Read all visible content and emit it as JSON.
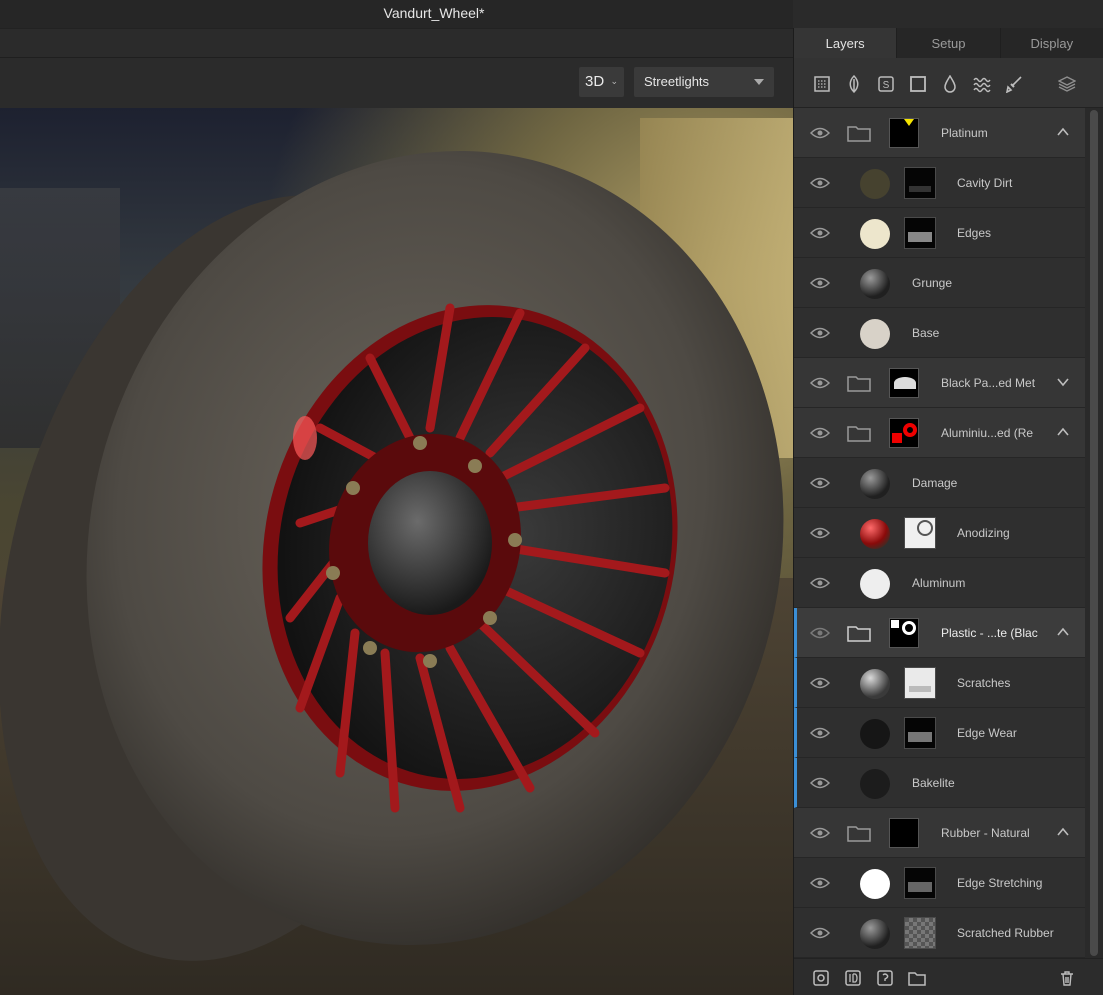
{
  "window": {
    "title": "Vandurt_Wheel*"
  },
  "viewport_toolbar": {
    "view_mode": "3D",
    "environment": "Streetlights"
  },
  "panel": {
    "tabs": [
      {
        "label": "Layers",
        "active": true
      },
      {
        "label": "Setup",
        "active": false
      },
      {
        "label": "Display",
        "active": false
      }
    ],
    "toolbar_icons": [
      "grid-icon",
      "leaf-icon",
      "smart-material-icon",
      "square-icon",
      "drop-icon",
      "waves-icon",
      "brush-icon",
      "layers-stack-icon"
    ],
    "layers": [
      {
        "type": "group",
        "label": "Platinum",
        "expanded": true
      },
      {
        "type": "child",
        "label": "Cavity Dirt",
        "ball": "#46422f",
        "has_mask": true
      },
      {
        "type": "child",
        "label": "Edges",
        "ball": "#ede6cc",
        "has_mask": true
      },
      {
        "type": "child",
        "label": "Grunge",
        "ball": "sphere-dark",
        "has_mask": false
      },
      {
        "type": "child",
        "label": "Base",
        "ball": "#d8d2c8",
        "has_mask": false
      },
      {
        "type": "group",
        "label": "Black Pa...ed Met",
        "expanded": false
      },
      {
        "type": "group",
        "label": "Aluminiu...ed (Re",
        "expanded": true
      },
      {
        "type": "child",
        "label": "Damage",
        "ball": "sphere-dark",
        "has_mask": false
      },
      {
        "type": "child",
        "label": "Anodizing",
        "ball": "sphere-red",
        "has_mask": true
      },
      {
        "type": "child",
        "label": "Aluminum",
        "ball": "#eeeeee",
        "has_mask": false
      },
      {
        "type": "group",
        "label": "Plastic - ...te (Blac",
        "expanded": true,
        "selected": true
      },
      {
        "type": "child",
        "label": "Scratches",
        "ball": "sphere-grey",
        "has_mask": true
      },
      {
        "type": "child",
        "label": "Edge Wear",
        "ball": "#161616",
        "has_mask": true
      },
      {
        "type": "child",
        "label": "Bakelite",
        "ball": "#1c1c1c",
        "has_mask": false
      },
      {
        "type": "group",
        "label": "Rubber - Natural",
        "expanded": true
      },
      {
        "type": "child",
        "label": "Edge Stretching",
        "ball": "#ffffff",
        "has_mask": true
      },
      {
        "type": "child",
        "label": "Scratched Rubber",
        "ball": "sphere-dark",
        "has_mask": true
      }
    ],
    "bottom_icons": [
      "add-fill-layer-icon",
      "add-id-layer-icon",
      "add-smart-layer-icon",
      "add-folder-icon",
      "delete-icon"
    ]
  }
}
